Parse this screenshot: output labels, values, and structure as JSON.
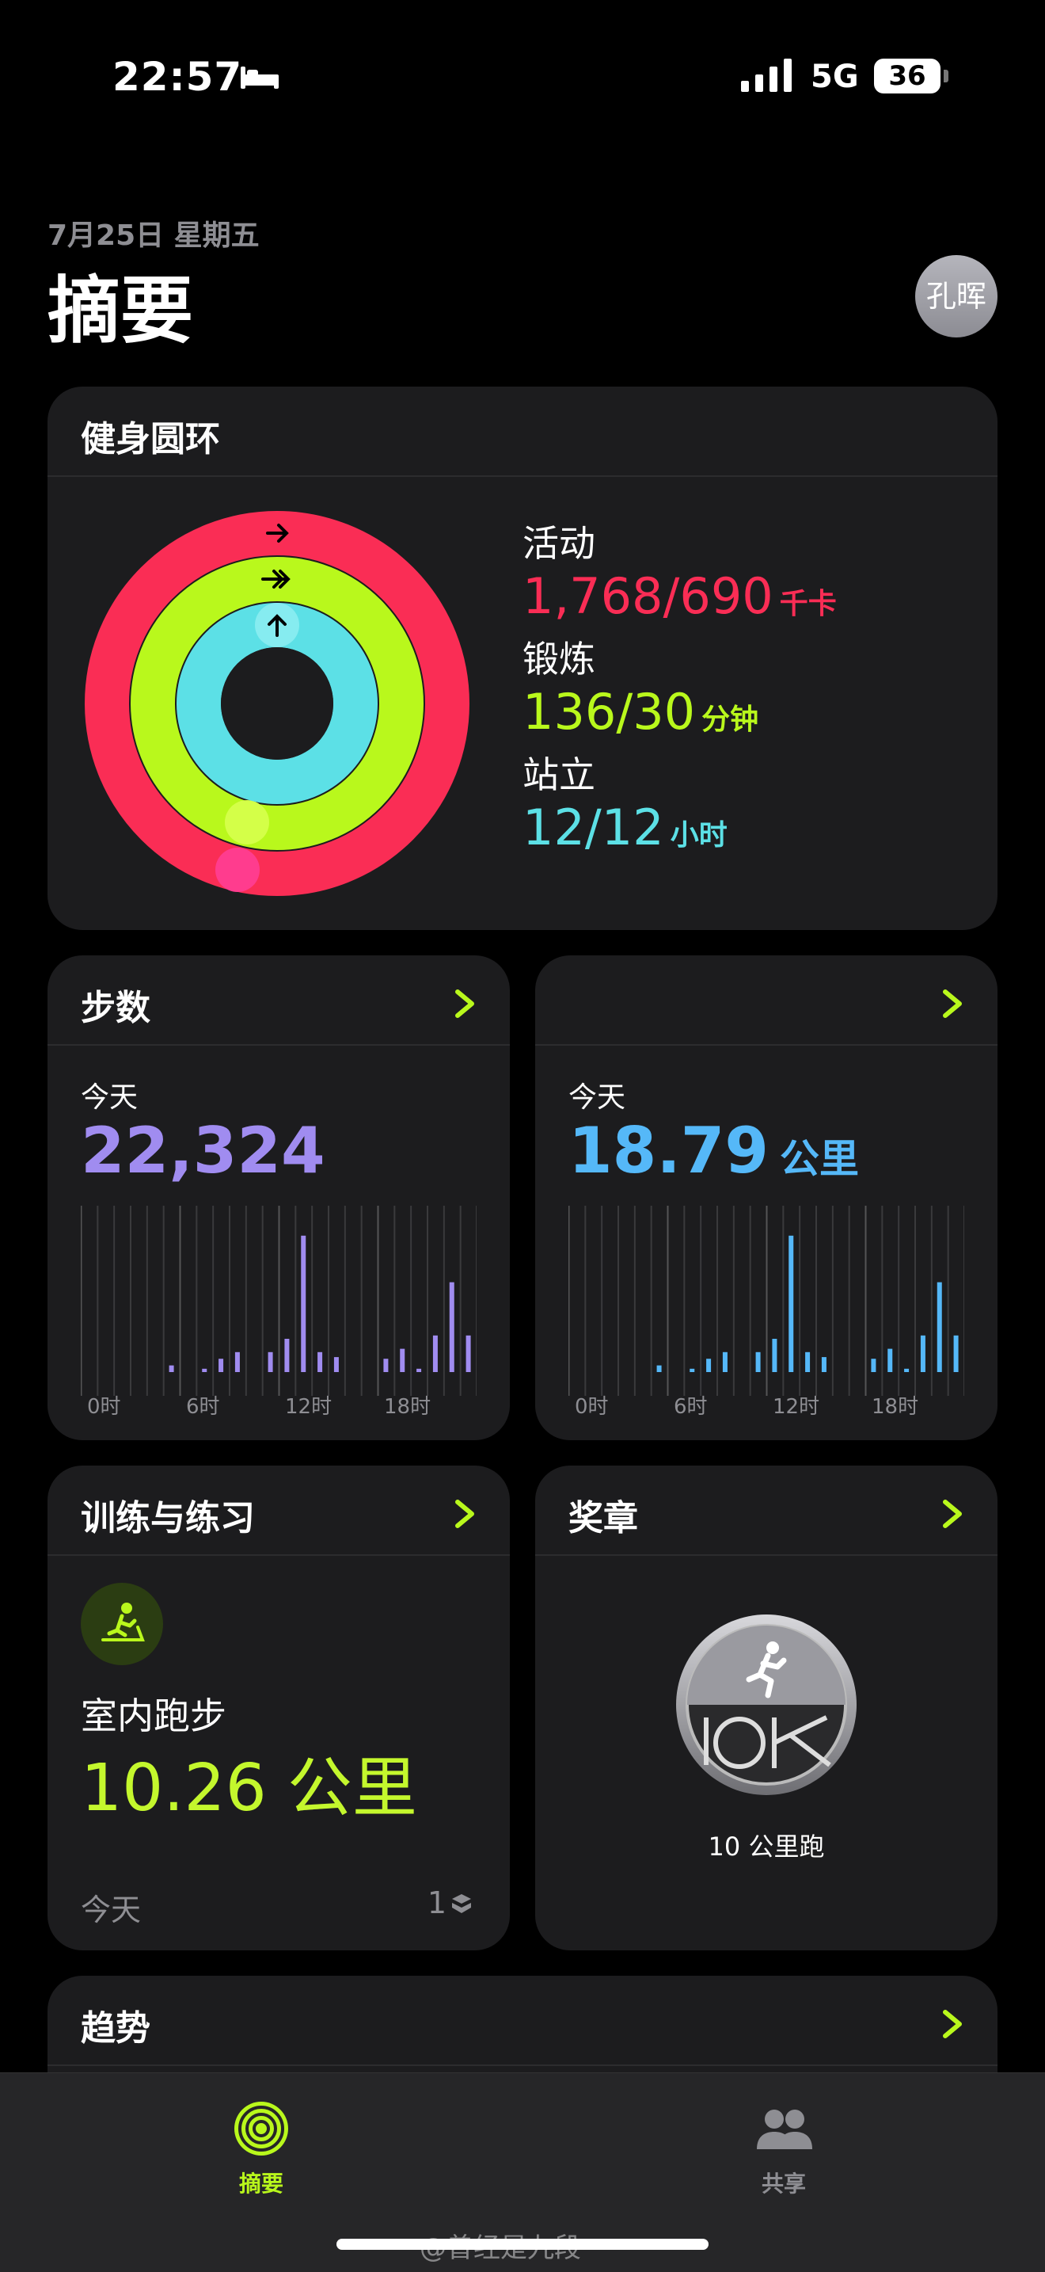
{
  "status_bar": {
    "time": "22:57",
    "network": "5G",
    "battery": "36"
  },
  "header": {
    "date": "7月25日 星期五",
    "title": "摘要",
    "avatar": "孔晖"
  },
  "rings": {
    "title": "健身圆环",
    "move": {
      "label": "活动",
      "value": "1,768/690",
      "unit": "千卡",
      "color": "#fa2d55"
    },
    "exercise": {
      "label": "锻炼",
      "value": "136/30",
      "unit": "分钟",
      "color": "#b9f81c"
    },
    "stand": {
      "label": "站立",
      "value": "12/12",
      "unit": "小时",
      "color": "#5ce0e6"
    }
  },
  "steps": {
    "title": "步数",
    "today": "今天",
    "value": "22,324",
    "color": "#a08cf0",
    "hours": [
      0,
      0,
      0,
      0,
      0,
      0.04,
      0,
      0.02,
      0.08,
      0.12,
      0,
      0.12,
      0.2,
      0.82,
      0.12,
      0.09,
      0,
      0,
      0.08,
      0.14,
      0.02,
      0.22,
      0.54,
      0.22
    ],
    "axis": [
      "0时",
      "6时",
      "12时",
      "18时"
    ]
  },
  "distance": {
    "title": "",
    "today": "今天",
    "value": "18.79",
    "unit": "公里",
    "color": "#55b8f8",
    "hours": [
      0,
      0,
      0,
      0,
      0,
      0.04,
      0,
      0.02,
      0.08,
      0.12,
      0,
      0.12,
      0.2,
      0.82,
      0.12,
      0.09,
      0,
      0,
      0.08,
      0.14,
      0.02,
      0.22,
      0.54,
      0.22
    ],
    "axis": [
      "0时",
      "6时",
      "12时",
      "18时"
    ]
  },
  "workouts": {
    "title": "训练与练习",
    "type": "室内跑步",
    "value": "10.26 公里",
    "today": "今天",
    "count": "1"
  },
  "awards": {
    "title": "奖章",
    "medal_label": "10 公里跑"
  },
  "trends": {
    "title": "趋势"
  },
  "tabbar": {
    "summary": "摘要",
    "sharing": "共享"
  },
  "watermark": "@曾经是九段"
}
